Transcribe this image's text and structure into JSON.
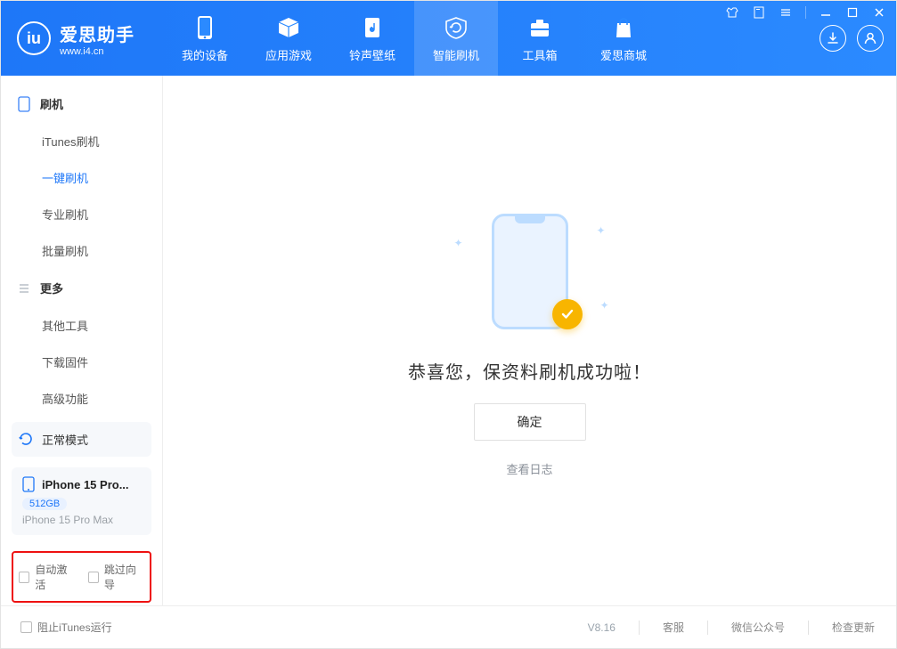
{
  "brand": {
    "name": "爱思助手",
    "url": "www.i4.cn"
  },
  "nav": [
    {
      "label": "我的设备"
    },
    {
      "label": "应用游戏"
    },
    {
      "label": "铃声壁纸"
    },
    {
      "label": "智能刷机"
    },
    {
      "label": "工具箱"
    },
    {
      "label": "爱思商城"
    }
  ],
  "sidebar": {
    "section1": {
      "title": "刷机",
      "items": [
        "iTunes刷机",
        "一键刷机",
        "专业刷机",
        "批量刷机"
      ]
    },
    "section2": {
      "title": "更多",
      "items": [
        "其他工具",
        "下载固件",
        "高级功能"
      ]
    },
    "status": "正常模式",
    "device": {
      "icon": "phone",
      "name": "iPhone 15 Pro...",
      "storage": "512GB",
      "model": "iPhone 15 Pro Max"
    },
    "options": {
      "autoActivate": "自动激活",
      "skipWizard": "跳过向导"
    }
  },
  "main": {
    "message": "恭喜您，保资料刷机成功啦！",
    "confirm": "确定",
    "viewLog": "查看日志"
  },
  "footer": {
    "blockItunes": "阻止iTunes运行",
    "version": "V8.16",
    "links": [
      "客服",
      "微信公众号",
      "检查更新"
    ]
  }
}
